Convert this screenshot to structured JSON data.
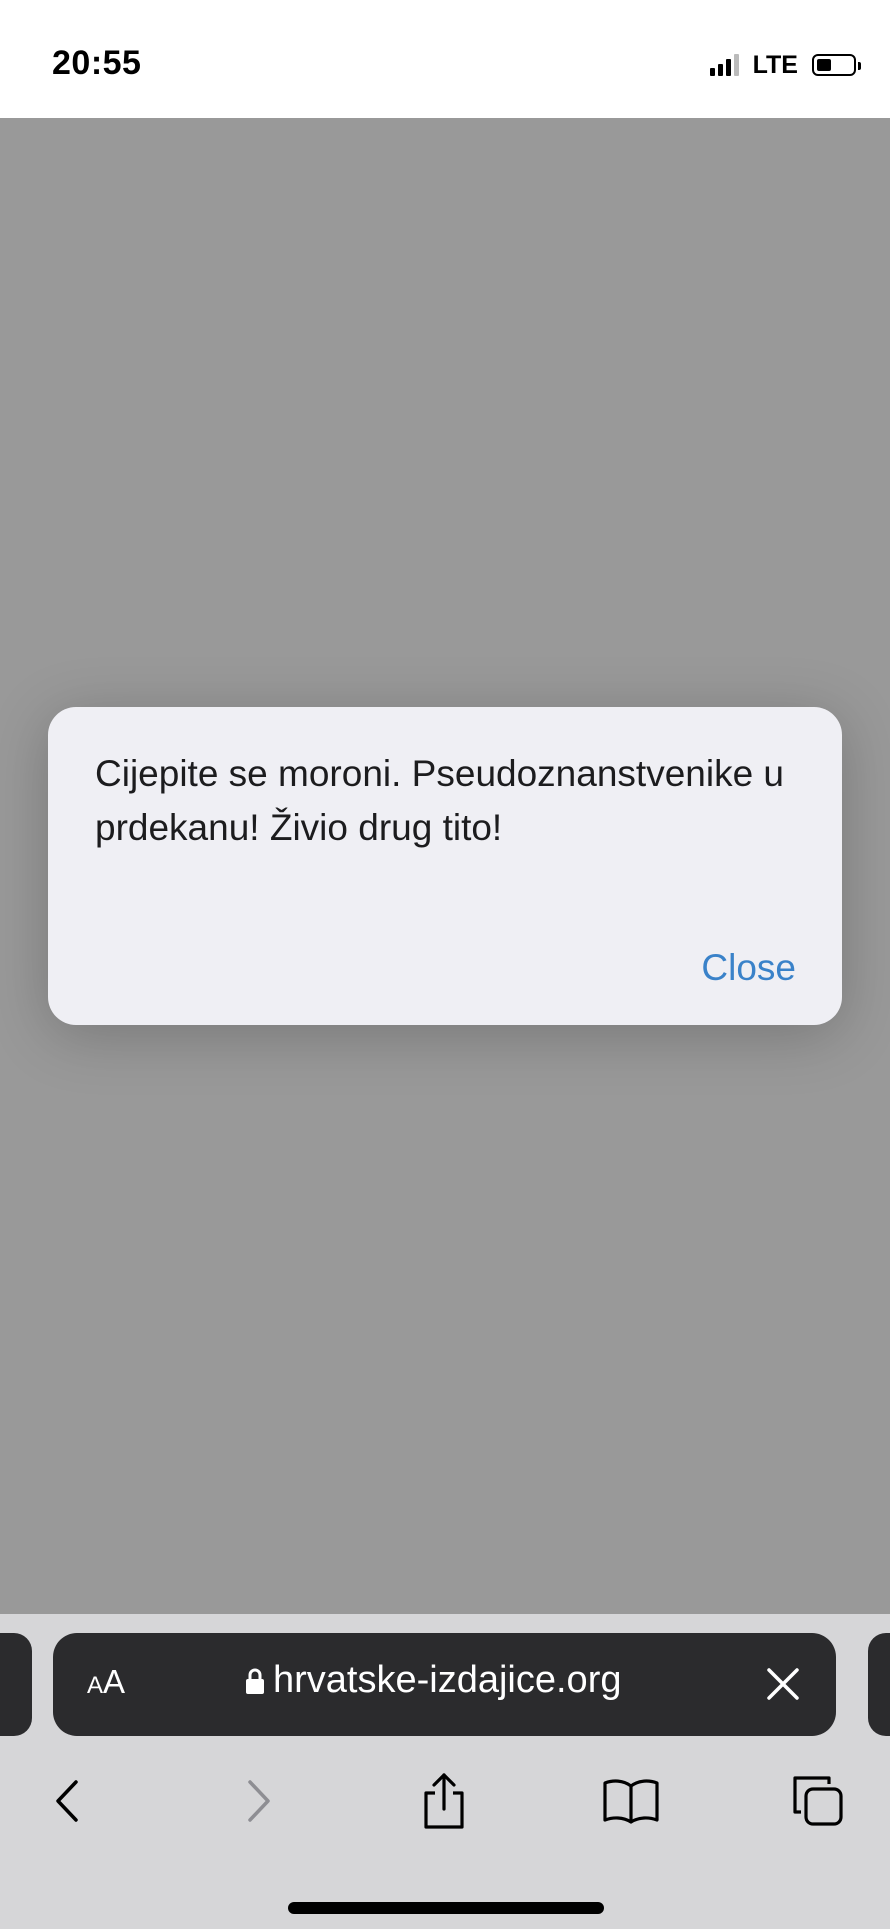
{
  "status_bar": {
    "time": "20:55",
    "network": "LTE"
  },
  "alert": {
    "message": "Cijepite se moroni. Pseudoznanstvenike u prdekanu! Živio drug tito!",
    "close_label": "Close",
    "close_color": "#3a82c9"
  },
  "address_bar": {
    "text_size_label_small": "A",
    "text_size_label_large": "A",
    "url": "hrvatske-izdajice.org"
  },
  "toolbar": {
    "icons": [
      "back-icon",
      "forward-icon",
      "share-icon",
      "bookmarks-icon",
      "tabs-icon"
    ]
  }
}
